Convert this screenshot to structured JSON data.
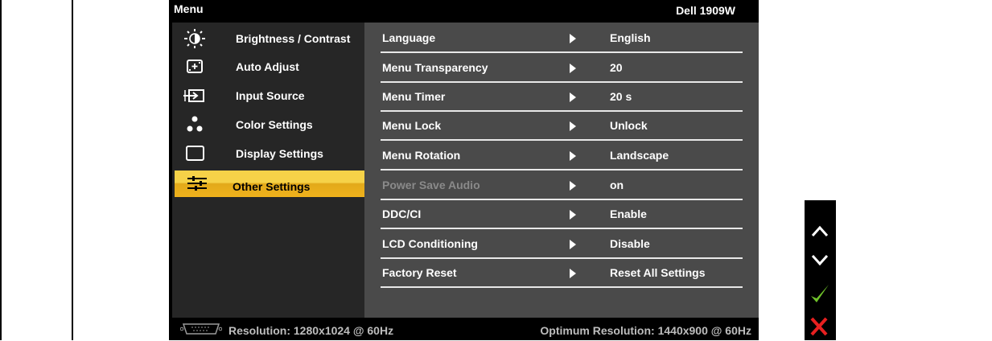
{
  "osd": {
    "title": "Menu",
    "model": "Dell 1909W",
    "menu_items": [
      {
        "label": "Brightness / Contrast",
        "icon": "brightness-icon"
      },
      {
        "label": "Auto Adjust",
        "icon": "auto-adjust-icon"
      },
      {
        "label": "Input Source",
        "icon": "input-source-icon"
      },
      {
        "label": "Color Settings",
        "icon": "color-settings-icon"
      },
      {
        "label": "Display Settings",
        "icon": "display-settings-icon"
      },
      {
        "label": "Other Settings",
        "icon": "other-settings-icon",
        "selected": true
      }
    ],
    "settings": [
      {
        "name": "Language",
        "value": "English"
      },
      {
        "name": "Menu Transparency",
        "value": "20"
      },
      {
        "name": "Menu Timer",
        "value": "20 s"
      },
      {
        "name": "Menu Lock",
        "value": "Unlock"
      },
      {
        "name": "Menu Rotation",
        "value": "Landscape"
      },
      {
        "name": "Power Save Audio",
        "value": "on",
        "disabled": true
      },
      {
        "name": "DDC/CI",
        "value": "Enable"
      },
      {
        "name": "LCD Conditioning",
        "value": "Disable"
      },
      {
        "name": "Factory Reset",
        "value": "Reset All Settings"
      }
    ],
    "footer": {
      "resolution": "Resolution: 1280x1024 @ 60Hz",
      "optimum": "Optimum Resolution: 1440x900 @ 60Hz",
      "input_icon": "vga-icon"
    }
  },
  "buttons": {
    "up_icon": "chevron-up-icon",
    "down_icon": "chevron-down-icon",
    "ok_icon": "checkmark-icon",
    "exit_icon": "close-icon"
  },
  "colors": {
    "selected_highlight": "#f0b21c",
    "check": "#6fc22a",
    "exit": "#e82020"
  }
}
